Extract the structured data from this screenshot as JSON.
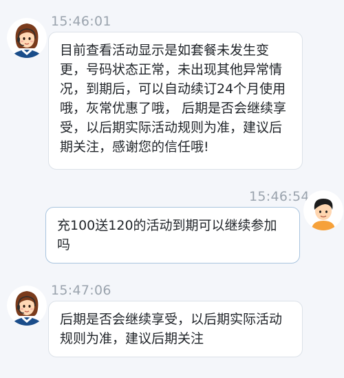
{
  "conversation": {
    "messages": [
      {
        "sender": "agent",
        "time": "15:46:01",
        "text": "目前查看活动显示是如套餐未发生变更，号码状态正常，未出现其他异常情况，到期后，可以自动续订24个月使用哦，灰常优惠了哦， 后期是否会继续享受，以后期实际活动规则为准，建议后期关注，感谢您的信任哦!"
      },
      {
        "sender": "user",
        "time": "15:46:54",
        "text": "充100送120的活动到期可以继续参加吗"
      },
      {
        "sender": "agent",
        "time": "15:47:06",
        "text": "后期是否会继续享受，以后期实际活动规则为准，建议后期关注"
      }
    ]
  },
  "colors": {
    "background": "#f4f6fa",
    "bubble": "#ffffff",
    "timestamp": "#9aa3ad",
    "user_bubble_border": "#a8c4de"
  },
  "icons": {
    "agent_avatar": "female-agent-headset-avatar",
    "user_avatar": "male-user-avatar"
  }
}
